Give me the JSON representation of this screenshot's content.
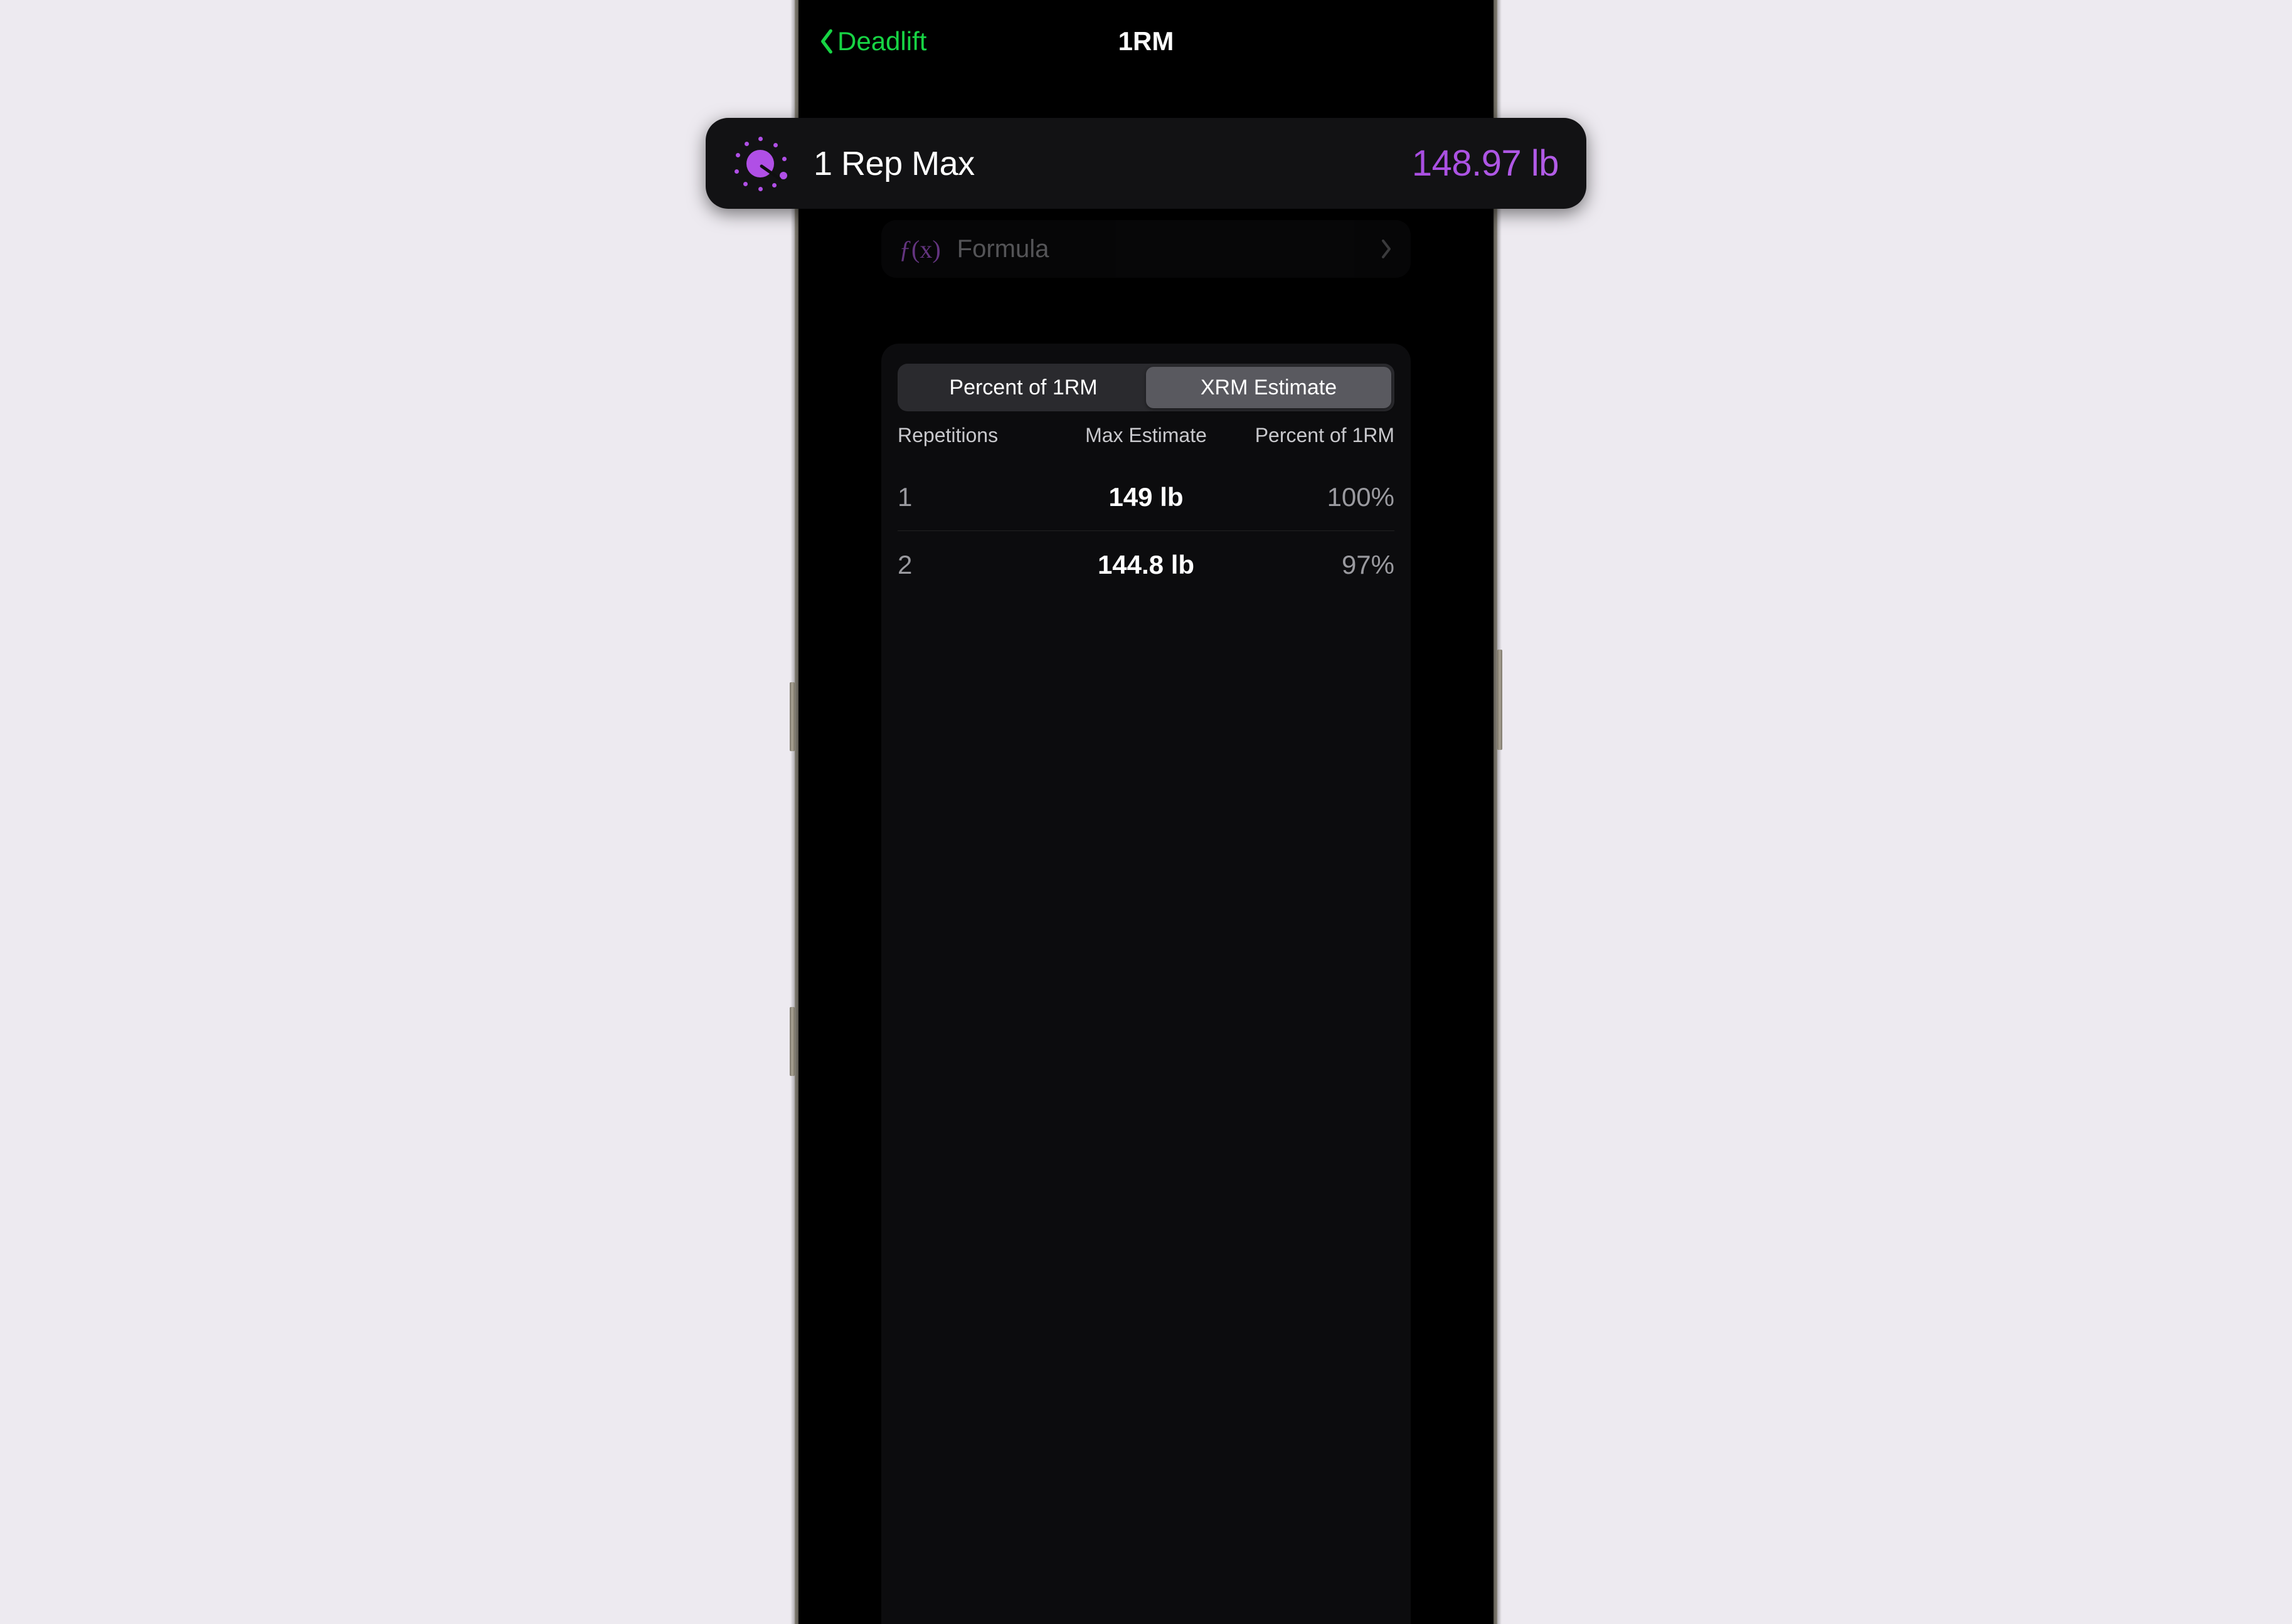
{
  "nav": {
    "back_label": "Deadlift",
    "title": "1RM"
  },
  "hero": {
    "label": "1 Rep Max",
    "value": "148.97 lb"
  },
  "formula": {
    "icon_text": "f(x)",
    "label": "Formula"
  },
  "segmented": {
    "percent_label": "Percent of 1RM",
    "xrm_label": "XRM Estimate",
    "active": "xrm"
  },
  "table": {
    "headers": {
      "reps": "Repetitions",
      "max": "Max Estimate",
      "pct": "Percent of 1RM"
    },
    "rows": [
      {
        "reps": "1",
        "max": "149 lb",
        "pct": "100%"
      },
      {
        "reps": "2",
        "max": "144.8 lb",
        "pct": "97%"
      }
    ]
  },
  "colors": {
    "accent_green": "#17d444",
    "accent_purple": "#b04fe6"
  }
}
